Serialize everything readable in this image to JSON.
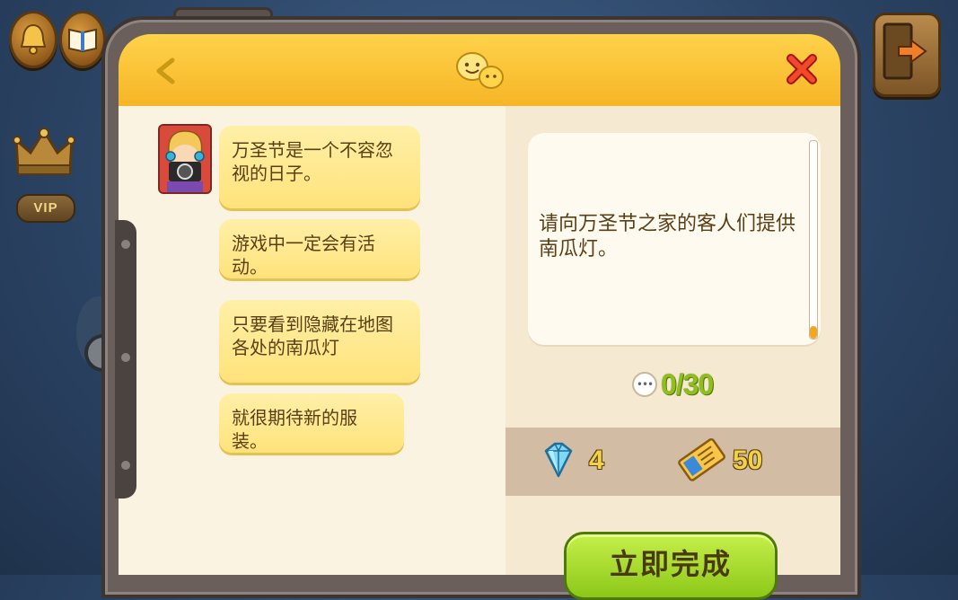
{
  "hud": {
    "vip_label": "VIP"
  },
  "dialog": {
    "messages": [
      "万圣节是一个不容忽视的日子。",
      "游戏中一定会有活动。",
      "只要看到隐藏在地图各处的南瓜灯",
      "就很期待新的服装。"
    ]
  },
  "quest": {
    "description": "请向万圣节之家的客人们提供南瓜灯。",
    "progress_text": "0/30",
    "progress_fraction": 0,
    "progress_icon_text": "•••"
  },
  "rewards": [
    {
      "icon": "diamond-icon",
      "value": "4"
    },
    {
      "icon": "ticket-icon",
      "value": "50"
    }
  ],
  "actions": {
    "complete_label": "立即完成"
  },
  "colors": {
    "header": "#f6b526",
    "progress_green": "#8fbf1a",
    "button_green": "#8cc818",
    "bubble_yellow": "#ffe27a"
  }
}
